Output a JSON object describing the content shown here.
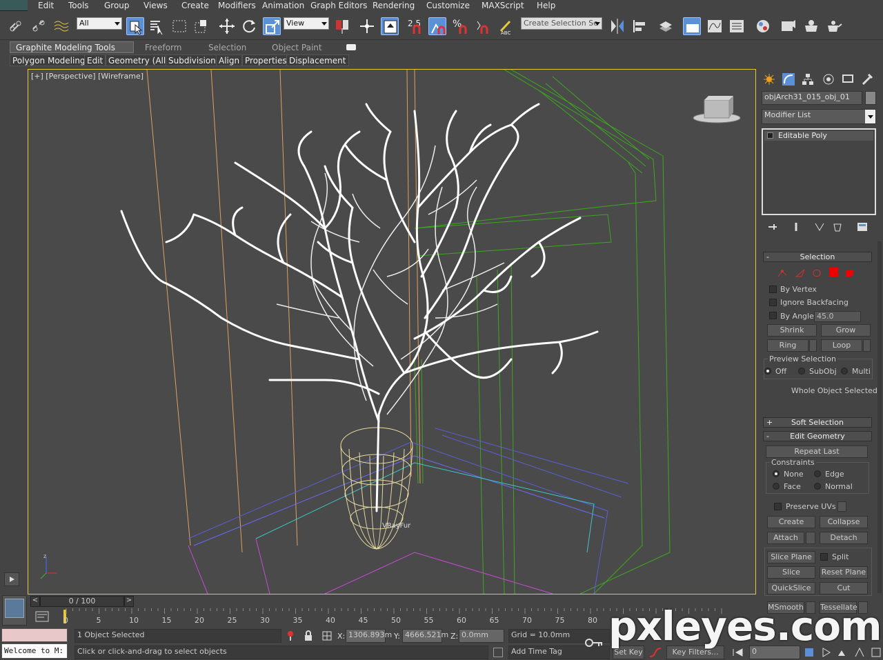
{
  "menu": [
    "Edit",
    "Tools",
    "Group",
    "Views",
    "Create",
    "Modifiers",
    "Animation",
    "Graph Editors",
    "Rendering",
    "Customize",
    "MAXScript",
    "Help"
  ],
  "toolbar": {
    "filter_value": "All",
    "refcoord_value": "View",
    "snap_angle": "2.5",
    "selection_set_placeholder": "Create Selection Se"
  },
  "ribbon": {
    "tabs": [
      "Graphite Modeling Tools",
      "Freeform",
      "Selection",
      "Object Paint"
    ],
    "subtabs": [
      "Polygon Modeling",
      "Edit",
      "Geometry (All)",
      "Subdivision",
      "Align",
      "Properties",
      "Displacement"
    ]
  },
  "viewport": {
    "label": "[+] [Perspective] [Wireframe]",
    "annotation": "VRayFur"
  },
  "panel": {
    "object_name": "objArch31_015_obj_01",
    "modifier_list": "Modifier List",
    "stack_item": "Editable Poly",
    "selection": {
      "title": "Selection",
      "by_vertex": "By Vertex",
      "ignore_backfacing": "Ignore Backfacing",
      "by_angle": "By Angle:",
      "angle_value": "45.0",
      "shrink": "Shrink",
      "grow": "Grow",
      "ring": "Ring",
      "loop": "Loop",
      "preview_title": "Preview Selection",
      "preview_off": "Off",
      "preview_subobj": "SubObj",
      "preview_multi": "Multi",
      "status": "Whole Object Selected"
    },
    "soft_selection": "Soft Selection",
    "edit_geometry": {
      "title": "Edit Geometry",
      "repeat_last": "Repeat Last",
      "constraints": "Constraints",
      "none": "None",
      "edge": "Edge",
      "face": "Face",
      "normal": "Normal",
      "preserve_uvs": "Preserve UVs",
      "create": "Create",
      "collapse": "Collapse",
      "attach": "Attach",
      "detach": "Detach",
      "slice_plane": "Slice Plane",
      "split": "Split",
      "slice": "Slice",
      "reset_plane": "Reset Plane",
      "quickslice": "QuickSlice",
      "cut": "Cut",
      "msmooth": "MSmooth",
      "tessellate": "Tessellate"
    }
  },
  "timeline": {
    "frame": "0 / 100",
    "ticks": [
      "0",
      "5",
      "10",
      "15",
      "20",
      "25",
      "30",
      "35",
      "40",
      "45",
      "50",
      "55",
      "60",
      "65",
      "70",
      "75",
      "80"
    ]
  },
  "status": {
    "maxscript": "Welcome to M:",
    "selected": "1 Object Selected",
    "prompt": "Click or click-and-drag to select objects",
    "x_label": "X:",
    "x_value": "1306.893m",
    "y_label": "Y:",
    "y_value": "4666.521m",
    "z_label": "Z:",
    "z_value": "0.0mm",
    "grid": "Grid = 10.0mm",
    "add_time_tag": "Add Time Tag",
    "set_key": "Set Key",
    "key_filters": "Key Filters...",
    "frame_value": "0"
  },
  "watermark": "pxleyes.com",
  "colors": {
    "accent": "#e6c83c",
    "active": "#5b8fd6",
    "tree": "#ffffff",
    "pot": "#e8dca0",
    "room_green": "#3ca81e"
  }
}
